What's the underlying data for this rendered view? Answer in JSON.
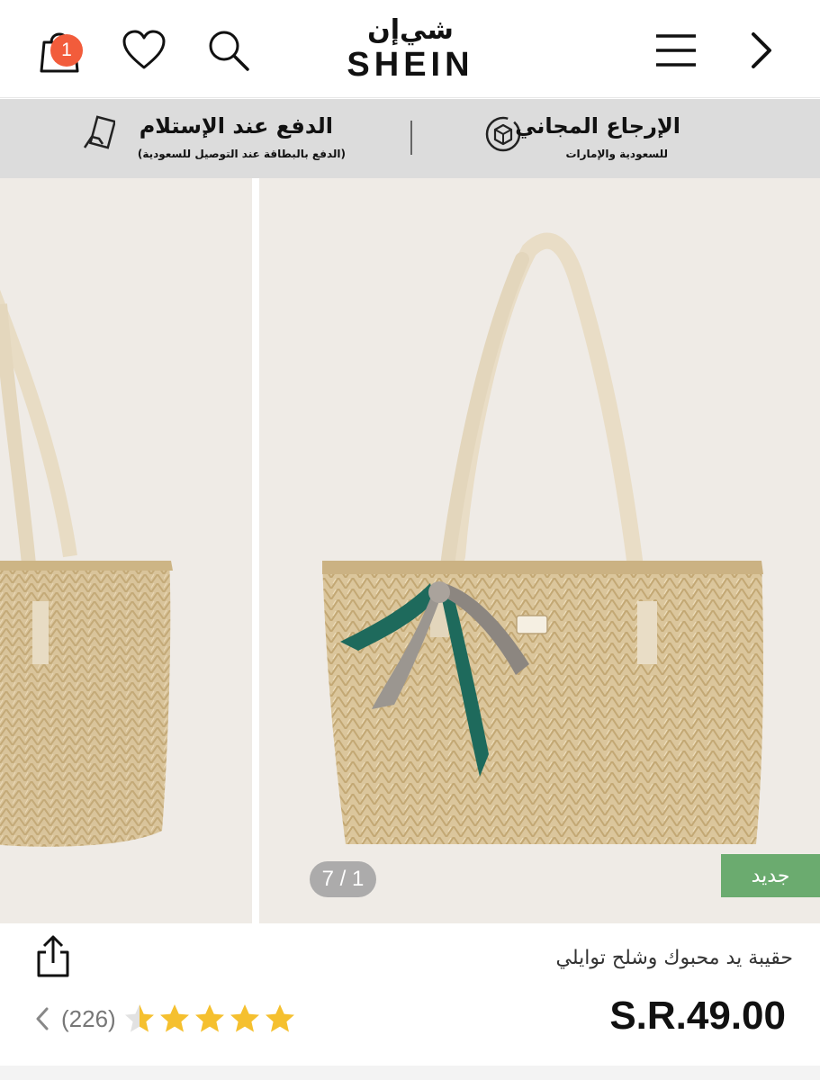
{
  "header": {
    "cart_badge": "1",
    "logo_arabic": "شي‌إن",
    "logo_latin": "SHEIN",
    "icons": [
      "cart-icon",
      "heart-icon",
      "search-icon",
      "menu-icon",
      "back-chevron-icon"
    ]
  },
  "promo": {
    "free_return_title": "الإرجاع المجاني",
    "free_return_sub": "للسعودية والإمارات",
    "cod_title": "الدفع عند الإستلام",
    "cod_sub": "(الدفع بالبطاقة عند التوصيل للسعودية)",
    "icons": [
      "box-return-icon",
      "cash-hand-icon"
    ]
  },
  "gallery": {
    "counter": "7 / 1",
    "new_tag": "جديد"
  },
  "product": {
    "title": "حقيبة يد محبوك وشلح توايلي",
    "price": "S.R.49.00",
    "review_count": "(226)",
    "rating": 4.5,
    "rating_max": 5
  },
  "colors": {
    "badge": "#f25c3b",
    "new_tag": "#6bab6f",
    "star": "#f5c02f",
    "promo_bg": "#dcdcdc"
  }
}
